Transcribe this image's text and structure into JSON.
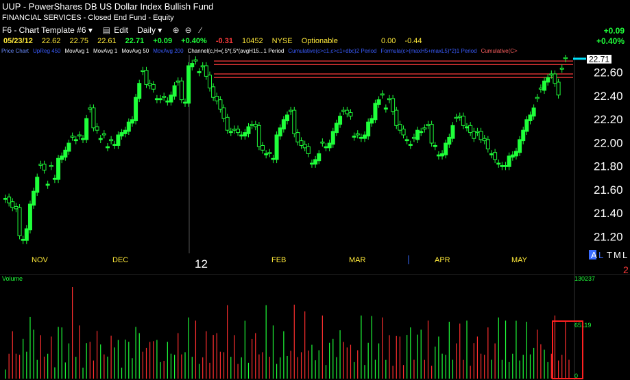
{
  "title": {
    "symbol": "UUP",
    "separator": " - ",
    "name": "PowerShares DB US Dollar Index Bullish Fund"
  },
  "info": "FINANCIAL SERVICES - Closed End Fund - Equity",
  "toolbar": {
    "template": "F6 - Chart Template #6",
    "edit": "Edit",
    "period": "Daily"
  },
  "quote": {
    "date": "05/23/12",
    "open": "22.62",
    "high": "22.75",
    "low": "22.61",
    "last": "22.71",
    "change": "+0.09",
    "pct": "+0.40%",
    "neg": "-0.31",
    "volume": "10452",
    "exchange": "NYSE",
    "optionable": "Optionable",
    "v1": "0.00",
    "v2": "-0.44"
  },
  "right_change": {
    "change": "+0.09",
    "pct": "+0.40%"
  },
  "studies": [
    {
      "label": "Price Chart",
      "color": "#6a8cff"
    },
    {
      "label": "UpReg 450",
      "color": "#3a5cff"
    },
    {
      "label": "MovAvg 1",
      "color": "#ffffff"
    },
    {
      "label": "MovAvg 1",
      "color": "#ffffff"
    },
    {
      "label": "MovAvg 50",
      "color": "#ffffff"
    },
    {
      "label": "MovAvg 200",
      "color": "#3a5cff"
    },
    {
      "label": "Channel(c,H=(.5*(.5*(avgH15...1 Period",
      "color": "#ffffff"
    },
    {
      "label": "Cumulative(c>c1,c>c1+dbc)2 Period",
      "color": "#3a5cff"
    },
    {
      "label": "Formula(c>(maxH5+maxL5)*2)1 Period",
      "color": "#3a5cff"
    },
    {
      "label": "Cumulative(C>",
      "color": "#ff6060"
    }
  ],
  "price_labels": [
    "22.60",
    "22.40",
    "22.20",
    "22.00",
    "21.80",
    "21.60",
    "21.40",
    "21.20"
  ],
  "last_price_tag": "22.71",
  "months": [
    "NOV",
    "DEC",
    "12",
    "FEB",
    "MAR",
    "APR",
    "MAY"
  ],
  "corner_letters": {
    "a": "A",
    "l": "L",
    "t": "T",
    "m": "M",
    "l2": "L",
    "num": "2"
  },
  "volume": {
    "title": "Volume",
    "max_label": "130237",
    "mid_label": "65119",
    "zero_label": "0"
  },
  "colors": {
    "up": "#1fff3a",
    "down": "#ff2f2f",
    "channel": "#ff3b3b",
    "price_tag": "#00e5ff",
    "highlight_box": "#ff2020"
  },
  "chart_data": {
    "type": "candlestick",
    "ylim": [
      21.05,
      22.72
    ],
    "y_ticks": [
      22.6,
      22.4,
      22.2,
      22.0,
      21.8,
      21.6,
      21.4,
      21.2
    ],
    "x_labels": [
      "NOV",
      "DEC",
      "12",
      "FEB",
      "MAR",
      "APR",
      "MAY"
    ],
    "channel_lines": [
      22.69,
      22.66,
      22.58,
      22.55
    ],
    "last": 22.71,
    "close": [
      21.52,
      21.48,
      21.44,
      21.43,
      21.2,
      21.17,
      21.26,
      21.47,
      21.58,
      21.7,
      21.8,
      21.76,
      21.64,
      21.79,
      21.69,
      21.86,
      21.88,
      21.93,
      21.99,
      22.04,
      22.02,
      22.05,
      22.03,
      22.2,
      22.28,
      22.12,
      22.1,
      22.03,
      22.06,
      21.96,
      22.01,
      21.98,
      22.06,
      22.08,
      22.1,
      22.17,
      22.19,
      22.38,
      22.5,
      22.6,
      22.49,
      22.48,
      22.45,
      22.37,
      22.37,
      22.38,
      22.35,
      22.4,
      22.48,
      22.51,
      22.36,
      22.34,
      22.65,
      22.67,
      22.69,
      22.6,
      22.64,
      22.56,
      22.46,
      22.38,
      22.35,
      22.28,
      22.2,
      22.1,
      22.09,
      22.1,
      22.08,
      22.06,
      22.08,
      22.13,
      22.14,
      22.13,
      21.96,
      21.93,
      21.9,
      21.9,
      21.86,
      22.06,
      22.12,
      22.19,
      22.23,
      22.26,
      22.07,
      22.0,
      21.97,
      21.95,
      21.9,
      21.82,
      21.85,
      21.9,
      21.99,
      21.96,
      21.99,
      22.09,
      22.16,
      22.22,
      22.26,
      22.24,
      22.22,
      22.05,
      22.06,
      22.04,
      22.06,
      22.17,
      22.2,
      22.33,
      22.36,
      22.4,
      22.29,
      22.36,
      22.26,
      22.14,
      22.1,
      22.06,
      22.02,
      21.98,
      22.03,
      22.1,
      22.09,
      22.11,
      22.14,
      21.99,
      21.97,
      21.89,
      21.9,
      21.99,
      22.04,
      22.14,
      22.2,
      22.21,
      22.14,
      22.13,
      22.08,
      22.03,
      22.08,
      22.02,
      22.01,
      21.94,
      21.9,
      21.85,
      21.82,
      21.8,
      21.8,
      21.88,
      21.89,
      21.92,
      22.02,
      22.1,
      22.19,
      22.23,
      22.29,
      22.37,
      22.45,
      22.52,
      22.55,
      22.57,
      22.5,
      22.4,
      22.62,
      22.71
    ],
    "up_down": [
      "up",
      "down",
      "down",
      "down",
      "down",
      "up",
      "up",
      "up",
      "up",
      "up",
      "down",
      "down",
      "up",
      "down",
      "up",
      "up",
      "up",
      "up",
      "up",
      "down",
      "up",
      "down",
      "up",
      "up",
      "down",
      "down",
      "down",
      "up",
      "down",
      "up",
      "down",
      "up",
      "up",
      "up",
      "up",
      "up",
      "up",
      "up",
      "up",
      "down",
      "down",
      "down",
      "down",
      "up",
      "up",
      "down",
      "up",
      "up",
      "up",
      "down",
      "down",
      "up",
      "up",
      "up",
      "down",
      "up",
      "down",
      "down",
      "down",
      "down",
      "down",
      "down",
      "down",
      "down",
      "up",
      "down",
      "down",
      "up",
      "up",
      "up",
      "down",
      "down",
      "down",
      "down",
      "up",
      "down",
      "up",
      "up",
      "up",
      "up",
      "up",
      "down",
      "down",
      "down",
      "down",
      "down",
      "down",
      "up",
      "up",
      "up",
      "down",
      "up",
      "up",
      "up",
      "up",
      "up",
      "down",
      "down",
      "down",
      "up",
      "down",
      "up",
      "up",
      "up",
      "up",
      "up",
      "up",
      "down",
      "up",
      "down",
      "down",
      "down",
      "down",
      "down",
      "up",
      "up",
      "down",
      "up",
      "up",
      "down",
      "down",
      "down",
      "up",
      "up",
      "up",
      "up",
      "up",
      "up",
      "down",
      "down",
      "down",
      "up",
      "down",
      "down",
      "down",
      "down",
      "down",
      "down",
      "up",
      "down",
      "up",
      "up",
      "up",
      "up",
      "up",
      "up",
      "up",
      "up",
      "up",
      "up",
      "up",
      "down",
      "down",
      "up",
      "up"
    ],
    "volume": [
      5,
      7,
      9,
      11,
      6,
      7,
      10,
      14,
      8,
      6,
      9,
      12,
      7,
      8,
      5,
      13,
      9,
      6,
      8,
      15,
      7,
      11,
      6,
      10,
      7,
      8,
      12,
      6,
      9,
      5,
      7,
      10,
      8,
      6,
      11,
      7,
      9,
      13,
      8,
      10,
      7,
      6,
      12,
      8,
      9,
      5,
      7,
      11,
      6,
      8,
      9,
      6,
      10,
      7,
      12,
      8,
      6,
      9,
      7,
      11,
      8,
      10,
      6,
      12,
      7,
      9,
      8,
      6,
      11,
      7,
      10,
      8,
      9,
      6,
      12,
      7,
      11,
      8,
      6,
      9,
      10,
      7,
      13,
      8,
      6,
      11,
      9,
      7,
      10,
      8,
      12,
      6,
      9,
      7,
      8,
      11,
      6,
      10,
      7,
      9,
      8,
      12,
      6,
      9,
      11,
      7,
      8,
      10,
      6,
      9,
      7,
      12,
      8,
      6,
      11,
      9,
      7,
      10,
      8,
      6,
      12,
      7,
      9,
      8,
      11,
      6,
      10,
      7,
      8,
      9,
      6,
      12,
      7,
      10,
      8,
      11,
      6,
      9,
      7,
      8,
      10,
      6,
      12,
      9,
      7,
      11,
      8,
      6,
      10,
      9,
      7,
      8,
      11,
      6,
      9,
      7,
      12,
      8,
      6,
      10,
      7
    ],
    "series": [
      {
        "name": "Volume",
        "values_ref": "volume"
      }
    ]
  }
}
